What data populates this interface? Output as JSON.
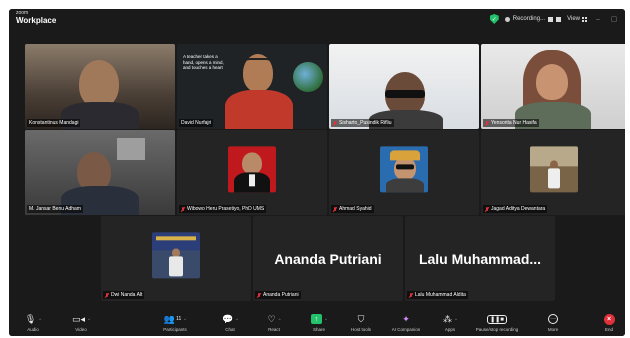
{
  "app": {
    "brand_top": "zoom",
    "brand_bottom": "Workplace"
  },
  "titlebar": {
    "recording_label": "Recording...",
    "view_label": "View"
  },
  "participants": [
    {
      "name": "Konstantinus Mandagi"
    },
    {
      "name": "David Nurfajri"
    },
    {
      "name": "Sisharto_Pusindik Rifliu"
    },
    {
      "name": "Yensorita Nur Hasifa"
    },
    {
      "name": "M. Jansar Benu Adham"
    },
    {
      "name": "Wibowo Heru Prasetiyo, PhD UMS"
    },
    {
      "name": "Ahmad Syahid"
    },
    {
      "name": "Jagad Aditya Dewantara"
    },
    {
      "name": "Dwi Nanda Alt"
    },
    {
      "name": "Ananda Putriani",
      "display": "Ananda Putriani"
    },
    {
      "name": "Lalu Muhammad Aldita",
      "display": "Lalu Muhammad..."
    }
  ],
  "slide_text": "A teacher takes a hand, opens a mind, and touches a heart",
  "toolbar": {
    "audio": "Audio",
    "video": "Video",
    "participants": "Participants",
    "participants_count": "11",
    "chat": "Chat",
    "react": "React",
    "share": "Share",
    "host_tools": "Host tools",
    "ai_companion": "AI Companion",
    "apps": "Apps",
    "pause_stop": "Pause/stop recording",
    "more": "More",
    "end": "End"
  },
  "colors": {
    "active_speaker": "#36c46b",
    "end_red": "#e0313a",
    "share_green": "#23c16b"
  }
}
